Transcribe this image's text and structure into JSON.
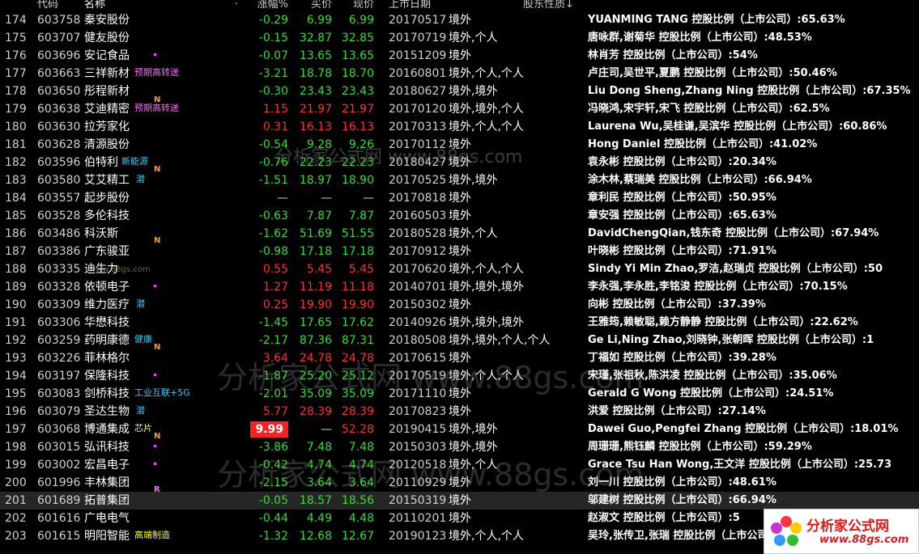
{
  "header": {
    "col_code": "代码",
    "col_name": "名称",
    "col_dot": "·",
    "col_chg": "涨幅%",
    "col_bid": "买价",
    "col_px": "现价",
    "col_date": "上市日期",
    "col_nature": "股东性质↓"
  },
  "rows": [
    {
      "idx": "174",
      "code": "603758",
      "name": "秦安股份",
      "chg": "-0.29",
      "bid": "6.99",
      "px": "6.99",
      "date": "20170517",
      "nature": "境外",
      "hold": "YUANMING TANG 控股比例（上市公司）:65.63%",
      "dir": "dn"
    },
    {
      "idx": "175",
      "code": "603707",
      "name": "健友股份",
      "chg": "-0.15",
      "bid": "32.87",
      "px": "32.85",
      "date": "20170719",
      "nature": "境外,个人",
      "hold": "唐咏群,谢菊华 控股比例（上市公司）:48.53%",
      "dir": "dn"
    },
    {
      "idx": "176",
      "code": "603696",
      "name": "安记食品",
      "chg": "-0.07",
      "bid": "13.65",
      "px": "13.65",
      "date": "20151209",
      "nature": "境外",
      "hold": "林肖芳 控股比例（上市公司）:54%",
      "dir": "dn"
    },
    {
      "idx": "177",
      "code": "603663",
      "name": "三祥新材",
      "chg": "-3.21",
      "bid": "18.78",
      "px": "18.70",
      "date": "20160801",
      "nature": "境外,个人,个人",
      "hold": "卢庄司,吴世平,夏鹏 控股比例（上市公司）:50.46%",
      "dir": "dn"
    },
    {
      "idx": "178",
      "code": "603650",
      "name": "彤程新材",
      "chg": "-0.30",
      "bid": "23.43",
      "px": "23.43",
      "date": "20180627",
      "nature": "境外,境外",
      "hold": "Liu Dong Sheng,Zhang Ning 控股比例（上市公司）:67.35%",
      "dir": "dn"
    },
    {
      "idx": "179",
      "code": "603638",
      "name": "艾迪精密",
      "chg": "1.15",
      "bid": "21.97",
      "px": "21.97",
      "date": "20170120",
      "nature": "境外,境外,个人",
      "hold": "冯晓鸿,宋宇轩,宋飞 控股比例（上市公司）:62.5%",
      "dir": "up"
    },
    {
      "idx": "180",
      "code": "603630",
      "name": "拉芳家化",
      "chg": "0.31",
      "bid": "16.13",
      "px": "16.13",
      "date": "20170313",
      "nature": "境外,个人,个人",
      "hold": "Laurena Wu,吴桂谦,吴滨华 控股比例（上市公司）:60.86%",
      "dir": "up"
    },
    {
      "idx": "181",
      "code": "603628",
      "name": "清源股份",
      "chg": "-0.54",
      "bid": "9.28",
      "px": "9.26",
      "date": "20170112",
      "nature": "境外",
      "hold": "Hong Daniel 控股比例（上市公司）:41.02%",
      "dir": "dn"
    },
    {
      "idx": "182",
      "code": "603596",
      "name": "伯特利",
      "chg": "-0.76",
      "bid": "22.23",
      "px": "22.23",
      "date": "20180427",
      "nature": "境外",
      "hold": "袁永彬 控股比例（上市公司）:20.34%",
      "dir": "dn"
    },
    {
      "idx": "183",
      "code": "603580",
      "name": "艾艾精工",
      "chg": "-1.51",
      "bid": "18.97",
      "px": "18.90",
      "date": "20170525",
      "nature": "境外,境外",
      "hold": "涂木林,蔡瑞美 控股比例（上市公司）:66.94%",
      "dir": "dn"
    },
    {
      "idx": "184",
      "code": "603557",
      "name": "起步股份",
      "chg": "—",
      "bid": "—",
      "px": "—",
      "date": "20170818",
      "nature": "境外",
      "hold": "章利民 控股比例（上市公司）:50.95%",
      "dir": "fl"
    },
    {
      "idx": "185",
      "code": "603528",
      "name": "多伦科技",
      "chg": "-0.63",
      "bid": "7.87",
      "px": "7.87",
      "date": "20160503",
      "nature": "境外",
      "hold": "章安强 控股比例（上市公司）:65.63%",
      "dir": "dn"
    },
    {
      "idx": "186",
      "code": "603486",
      "name": "科沃斯",
      "chg": "-1.62",
      "bid": "51.69",
      "px": "51.55",
      "date": "20180528",
      "nature": "境外,个人",
      "hold": "DavidChengQian,钱东奇 控股比例（上市公司）:67.94%",
      "dir": "dn"
    },
    {
      "idx": "187",
      "code": "603386",
      "name": "广东骏亚",
      "chg": "-0.98",
      "bid": "17.18",
      "px": "17.18",
      "date": "20170912",
      "nature": "境外",
      "hold": "叶晓彬 控股比例（上市公司）:71.91%",
      "dir": "dn"
    },
    {
      "idx": "188",
      "code": "603335",
      "name": "迪生力",
      "chg": "0.55",
      "bid": "5.45",
      "px": "5.45",
      "date": "20170620",
      "nature": "境外,个人,个人",
      "hold": "Sindy Yi Min Zhao,罗洁,赵瑞贞 控股比例（上市公司）:50",
      "dir": "up"
    },
    {
      "idx": "189",
      "code": "603328",
      "name": "依顿电子",
      "chg": "1.27",
      "bid": "11.19",
      "px": "11.18",
      "date": "20140701",
      "nature": "境外,境外,境外",
      "hold": "李永强,李永胜,李铭浚 控股比例（上市公司）:70.15%",
      "dir": "up"
    },
    {
      "idx": "190",
      "code": "603309",
      "name": "维力医疗",
      "chg": "0.25",
      "bid": "19.90",
      "px": "19.90",
      "date": "20150302",
      "nature": "境外",
      "hold": "向彬 控股比例（上市公司）:37.39%",
      "dir": "up"
    },
    {
      "idx": "191",
      "code": "603306",
      "name": "华懋科技",
      "chg": "-1.45",
      "bid": "17.65",
      "px": "17.62",
      "date": "20140926",
      "nature": "境外,境外,境外",
      "hold": "王雅筠,赖敏聪,赖方静静 控股比例（上市公司）:22.62%",
      "dir": "dn"
    },
    {
      "idx": "192",
      "code": "603259",
      "name": "药明康德",
      "chg": "-2.17",
      "bid": "87.36",
      "px": "87.31",
      "date": "20180508",
      "nature": "境外,境外,个人,个人",
      "hold": "Ge Li,Ning Zhao,刘晓钟,张朝晖 控股比例（上市公司）:1",
      "dir": "dn"
    },
    {
      "idx": "193",
      "code": "603226",
      "name": "菲林格尔",
      "chg": "3.64",
      "bid": "24.78",
      "px": "24.78",
      "date": "20170615",
      "nature": "境外",
      "hold": "丁福如 控股比例（上市公司）:39.28%",
      "dir": "up"
    },
    {
      "idx": "194",
      "code": "603197",
      "name": "保隆科技",
      "chg": "-1.87",
      "bid": "25.20",
      "px": "25.12",
      "date": "20170519",
      "nature": "境外,个人,个人",
      "hold": "宋瑾,张祖秋,陈洪凌 控股比例（上市公司）:35.06%",
      "dir": "dn"
    },
    {
      "idx": "195",
      "code": "603083",
      "name": "剑桥科技",
      "chg": "-2.01",
      "bid": "35.09",
      "px": "35.09",
      "date": "20171110",
      "nature": "境外",
      "hold": "Gerald G Wong 控股比例（上市公司）:24.51%",
      "dir": "dn"
    },
    {
      "idx": "196",
      "code": "603079",
      "name": "圣达生物",
      "chg": "5.77",
      "bid": "28.39",
      "px": "28.39",
      "date": "20170823",
      "nature": "境外",
      "hold": "洪爱 控股比例（上市公司）:27.14%",
      "dir": "up"
    },
    {
      "idx": "197",
      "code": "603068",
      "name": "博通集成",
      "chg": "9.99",
      "bid": "—",
      "px": "52.28",
      "date": "20190415",
      "nature": "境外,境外",
      "hold": "Dawei Guo,Pengfei Zhang 控股比例（上市公司）:18.01%",
      "dir": "limit"
    },
    {
      "idx": "198",
      "code": "603015",
      "name": "弘讯科技",
      "chg": "-3.86",
      "bid": "7.48",
      "px": "7.48",
      "date": "20150303",
      "nature": "境外,境外",
      "hold": "周珊珊,熊钰麟 控股比例（上市公司）:59.29%",
      "dir": "dn"
    },
    {
      "idx": "199",
      "code": "603002",
      "name": "宏昌电子",
      "chg": "-0.42",
      "bid": "4.74",
      "px": "4.74",
      "date": "20120518",
      "nature": "境外,个人",
      "hold": "Grace Tsu Han Wong,王文洋 控股比例（上市公司）:25.73",
      "dir": "dn"
    },
    {
      "idx": "200",
      "code": "601996",
      "name": "丰林集团",
      "chg": "-2.15",
      "bid": "3.64",
      "px": "3.64",
      "date": "20110929",
      "nature": "境外",
      "hold": "刘一川 控股比例（上市公司）:48.61%",
      "dir": "dn"
    },
    {
      "idx": "201",
      "code": "601689",
      "name": "拓普集团",
      "chg": "-0.05",
      "bid": "18.57",
      "px": "18.56",
      "date": "20150319",
      "nature": "境外",
      "hold": "邬建树 控股比例（上市公司）:66.94%",
      "dir": "dn"
    },
    {
      "idx": "202",
      "code": "601616",
      "name": "广电电气",
      "chg": "-0.44",
      "bid": "4.49",
      "px": "4.48",
      "date": "20110201",
      "nature": "境外",
      "hold": "赵淑文 控股比例（上市公司）:5",
      "dir": "dn"
    },
    {
      "idx": "203",
      "code": "601615",
      "name": "明阳智能",
      "chg": "-1.32",
      "bid": "12.68",
      "px": "12.67",
      "date": "20190123",
      "nature": "境外,个人,个人",
      "hold": "吴玲,张传卫,张瑞 控股比例（上市公司）:4",
      "dir": "dn"
    }
  ],
  "tags": {
    "t177": "预期高转送",
    "t179": "预期高转送",
    "t182a": "新能源",
    "t182b": "N",
    "t183": "潜",
    "t186": "N",
    "t190": "潜",
    "t192a": "健康",
    "t192b": "N",
    "t195": "工业互联+5G",
    "t196": "潜",
    "t197a": "芯片",
    "t197b": "N",
    "t200": "R",
    "t203": "高端制造"
  },
  "watermarks": {
    "wm1": "分析家公式网 www.88gs.com",
    "wm2": "分析家公式网 www.88gs.com",
    "wm3": "分析家公式网 www.88gs.com",
    "wm_small": "www.88gs.com"
  },
  "logo": {
    "title": "分析家公式网",
    "url": "www.88gs.com"
  },
  "colors": {
    "up": "#ff3030",
    "down": "#33dd33",
    "limit_bg": "#ff2020"
  }
}
